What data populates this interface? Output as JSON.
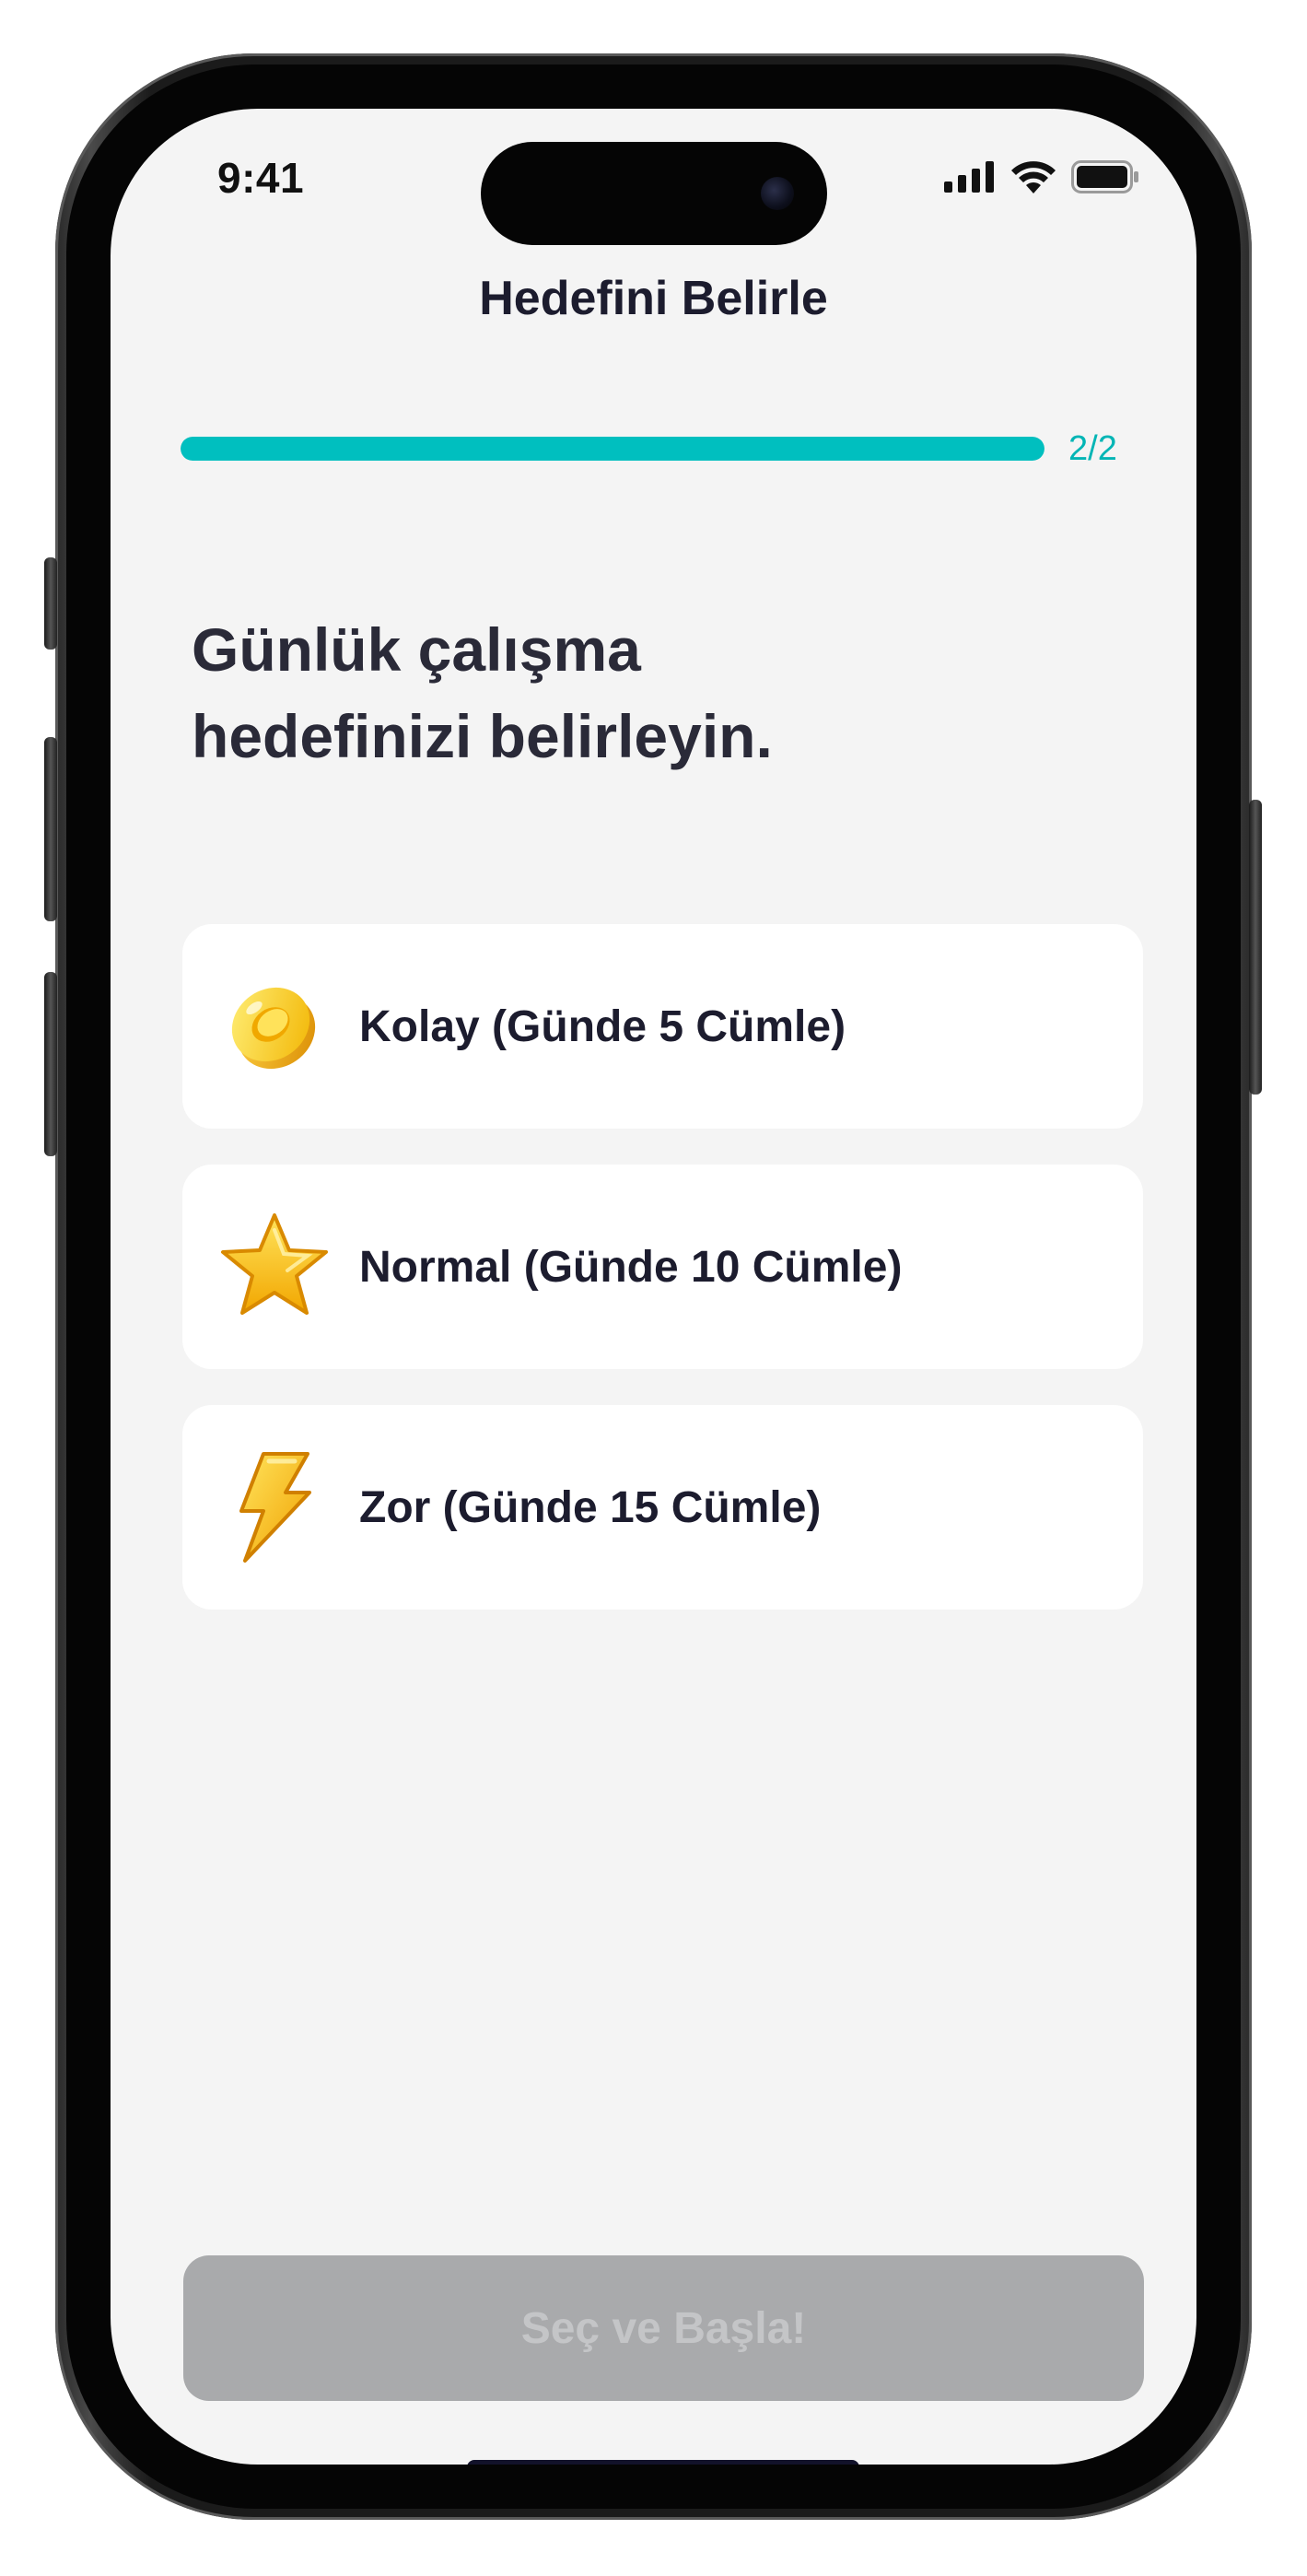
{
  "status_bar": {
    "time": "9:41",
    "icons": [
      "cellular-signal-icon",
      "wifi-icon",
      "battery-icon"
    ]
  },
  "header": {
    "title": "Hedefini Belirle"
  },
  "progress": {
    "label": "2/2",
    "value": 1.0,
    "color": "#00bfbf"
  },
  "question": {
    "line1": "Günlük çalışma",
    "line2": "hedefinizi belirleyin."
  },
  "options": [
    {
      "label": "Kolay (Günde 5 Cümle)",
      "icon": "coin-icon"
    },
    {
      "label": "Normal (Günde 10 Cümle)",
      "icon": "star-icon"
    },
    {
      "label": "Zor (Günde 15 Cümle)",
      "icon": "lightning-bolt-icon"
    }
  ],
  "cta": {
    "label": "Seç ve Başla!",
    "state": "disabled"
  },
  "colors": {
    "accent": "#00bfbf",
    "background": "#f4f4f4",
    "card": "#ffffff",
    "text_primary": "#1c1c2e",
    "button_disabled": "#a9aaac"
  }
}
